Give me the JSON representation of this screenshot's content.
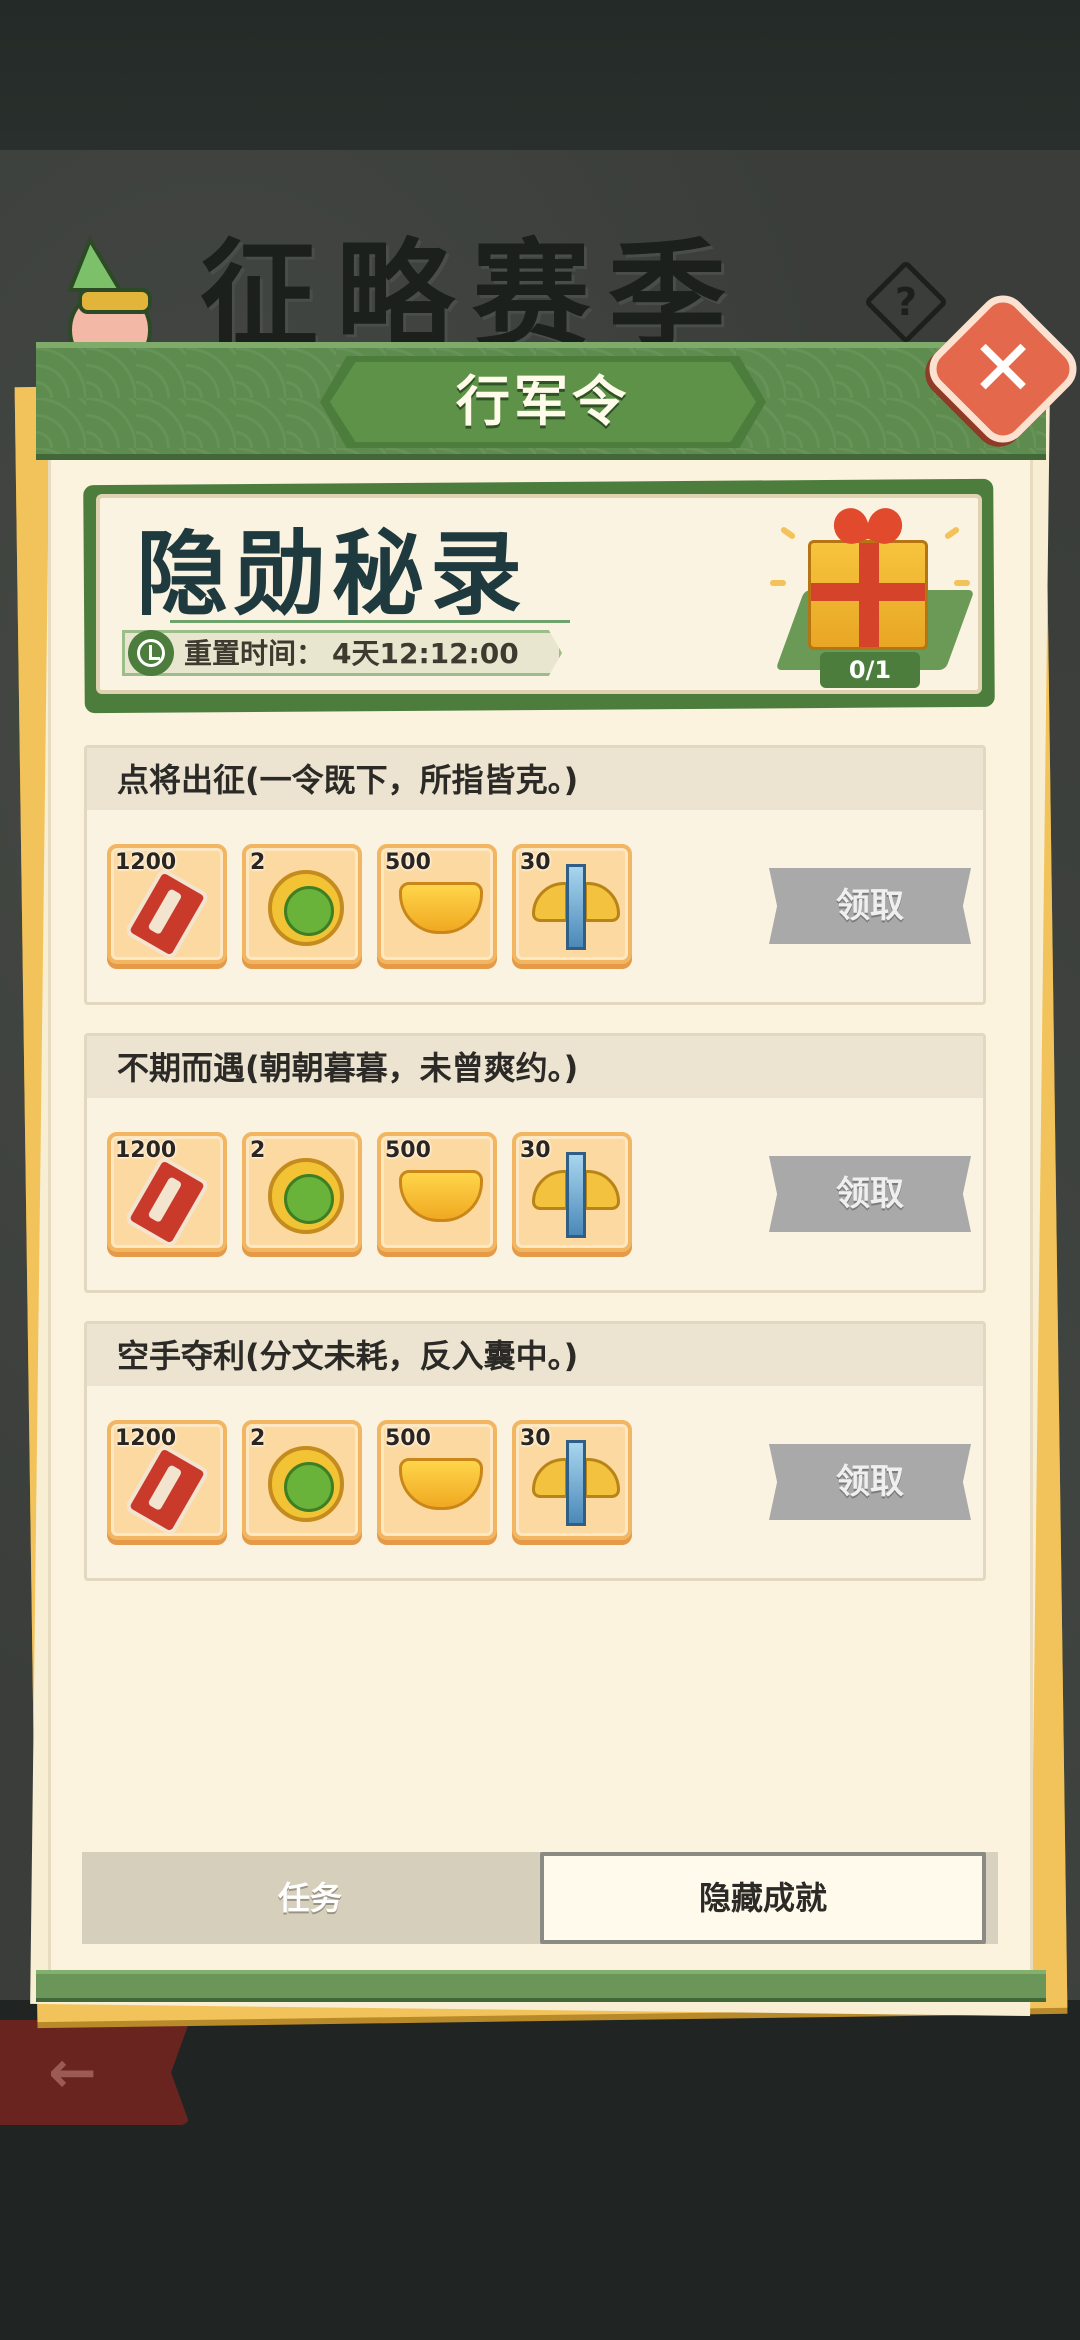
{
  "background": {
    "season_title": "征略赛季",
    "help_glyph": "?"
  },
  "header": {
    "title": "行军令",
    "close_glyph": "✕"
  },
  "banner": {
    "title": "隐勋秘录",
    "reset_label": "重置时间：",
    "reset_value": "4天12:12:00",
    "gift_progress": "0/1"
  },
  "tasks": [
    {
      "title": "点将出征(一令既下，所指皆克。)",
      "rewards": [
        {
          "icon": "scroll-icon",
          "count": "1200"
        },
        {
          "icon": "coin-icon",
          "count": "2"
        },
        {
          "icon": "gold-ingot-icon",
          "count": "500"
        },
        {
          "icon": "winged-sword-icon",
          "count": "30"
        }
      ],
      "button": "领取"
    },
    {
      "title": "不期而遇(朝朝暮暮，未曾爽约。)",
      "rewards": [
        {
          "icon": "scroll-icon",
          "count": "1200"
        },
        {
          "icon": "coin-icon",
          "count": "2"
        },
        {
          "icon": "gold-ingot-icon",
          "count": "500"
        },
        {
          "icon": "winged-sword-icon",
          "count": "30"
        }
      ],
      "button": "领取"
    },
    {
      "title": "空手夺利(分文未耗，反入囊中。)",
      "rewards": [
        {
          "icon": "scroll-icon",
          "count": "1200"
        },
        {
          "icon": "coin-icon",
          "count": "2"
        },
        {
          "icon": "gold-ingot-icon",
          "count": "500"
        },
        {
          "icon": "winged-sword-icon",
          "count": "30"
        }
      ],
      "button": "领取"
    }
  ],
  "tabs": {
    "task": "任务",
    "hidden": "隐藏成就",
    "active": "hidden"
  },
  "back_glyph": "←",
  "colors": {
    "accent_green": "#5d8c4e",
    "close_red": "#e4694c",
    "claim_disabled": "#a9a9a9",
    "reward_bg": "#fbd9a0"
  }
}
